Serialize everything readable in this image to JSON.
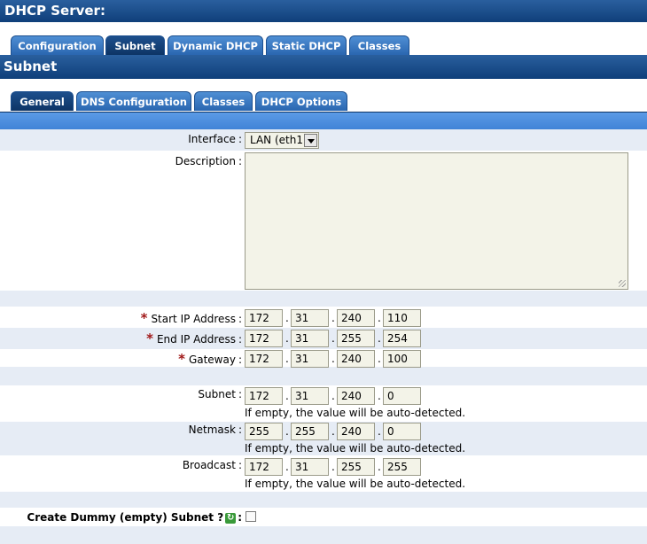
{
  "app": {
    "title": "DHCP Server:"
  },
  "top_tabs": [
    {
      "label": "Configuration"
    },
    {
      "label": "Subnet"
    },
    {
      "label": "Dynamic DHCP"
    },
    {
      "label": "Static DHCP"
    },
    {
      "label": "Classes"
    }
  ],
  "section": {
    "title": "Subnet"
  },
  "sub_tabs": [
    {
      "label": "General"
    },
    {
      "label": "DNS Configuration"
    },
    {
      "label": "Classes"
    },
    {
      "label": "DHCP Options"
    }
  ],
  "form": {
    "interface": {
      "label": "Interface",
      "value": "LAN (eth1)"
    },
    "description": {
      "label": "Description",
      "value": ""
    },
    "start_ip": {
      "label": "Start IP Address",
      "octets": [
        "172",
        "31",
        "240",
        "110"
      ]
    },
    "end_ip": {
      "label": "End IP Address",
      "octets": [
        "172",
        "31",
        "255",
        "254"
      ]
    },
    "gateway": {
      "label": "Gateway",
      "octets": [
        "172",
        "31",
        "240",
        "100"
      ]
    },
    "subnet": {
      "label": "Subnet",
      "octets": [
        "172",
        "31",
        "240",
        "0"
      ],
      "hint": "If empty, the value will be auto-detected."
    },
    "netmask": {
      "label": "Netmask",
      "octets": [
        "255",
        "255",
        "240",
        "0"
      ],
      "hint": "If empty, the value will be auto-detected."
    },
    "broadcast": {
      "label": "Broadcast",
      "octets": [
        "172",
        "31",
        "255",
        "255"
      ],
      "hint": "If empty, the value will be auto-detected."
    },
    "dummy": {
      "label": "Create Dummy (empty) Subnet ?",
      "checked": false
    },
    "colon": ":",
    "required_mark": "*"
  }
}
